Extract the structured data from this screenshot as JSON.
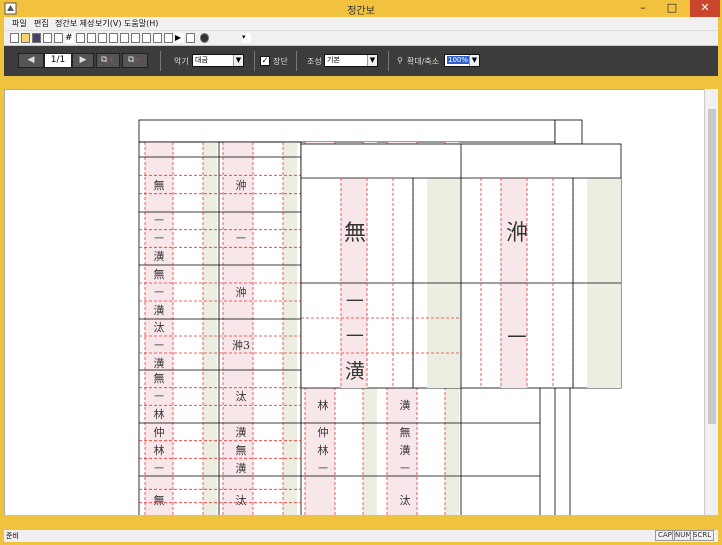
{
  "window": {
    "title": "정간보"
  },
  "menu": [
    "파일",
    "편집",
    "정간보 제성",
    "보기(V)",
    "도움말(H)"
  ],
  "toolbar": {
    "page": "1/1",
    "key_label": "악기",
    "key_value": "대금",
    "checkbox_label": "장단",
    "checkbox_checked": true,
    "scale_label": "조성",
    "scale_value": "기본",
    "zoom_label": "확대/축소",
    "zoom_value": "100%"
  },
  "status": {
    "text": "준비",
    "indicators": [
      "CAP",
      "NUM",
      "SCRL"
    ]
  },
  "score": {
    "header_box": "",
    "small_grid": {
      "col1": [
        "無",
        "ㅡ ㅡ 潢",
        "無 ㅡ 潢",
        "汰 ㅡ 潢",
        "無 ㅡ 林",
        "仲 林 ㅡ",
        "無"
      ],
      "col2": [
        "㳞",
        "ㅡ",
        "㳞",
        "㳞3",
        "汰",
        "潢 無 潢",
        "汰"
      ],
      "col3": [
        "ㅡ 林",
        "仲 林 ㅡ"
      ],
      "col4": [
        "ㅡ 潢",
        "無 潢 ㅡ",
        "汰"
      ]
    },
    "big_grid": {
      "c1_top": "無",
      "c1_bottom": "ㅡ ㅡ 潢",
      "c2_top": "㳞",
      "c2_bottom": "ㅡ"
    }
  }
}
